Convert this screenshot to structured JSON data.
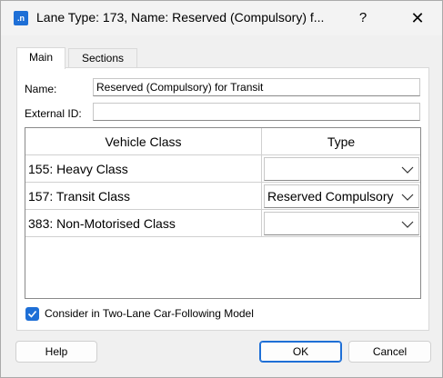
{
  "window": {
    "app_icon_text": ".n",
    "title": "Lane Type: 173, Name: Reserved (Compulsory) f...",
    "help_glyph": "?",
    "close_glyph": "✕"
  },
  "tabs": [
    {
      "label": "Main",
      "active": true
    },
    {
      "label": "Sections",
      "active": false
    }
  ],
  "form": {
    "name_label": "Name:",
    "name_value": "Reserved (Compulsory) for Transit",
    "external_id_label": "External ID:",
    "external_id_value": ""
  },
  "grid": {
    "headers": [
      "Vehicle Class",
      "Type"
    ],
    "rows": [
      {
        "vehicle_class": "155: Heavy Class",
        "type": ""
      },
      {
        "vehicle_class": "157: Transit Class",
        "type": "Reserved Compulsory"
      },
      {
        "vehicle_class": "383: Non-Motorised Class",
        "type": ""
      }
    ]
  },
  "checkbox": {
    "label": "Consider in Two-Lane Car-Following Model",
    "checked": true
  },
  "buttons": {
    "help": "Help",
    "ok": "OK",
    "cancel": "Cancel"
  },
  "colors": {
    "accent": "#1e6fd6",
    "background": "#f0f0f0"
  }
}
